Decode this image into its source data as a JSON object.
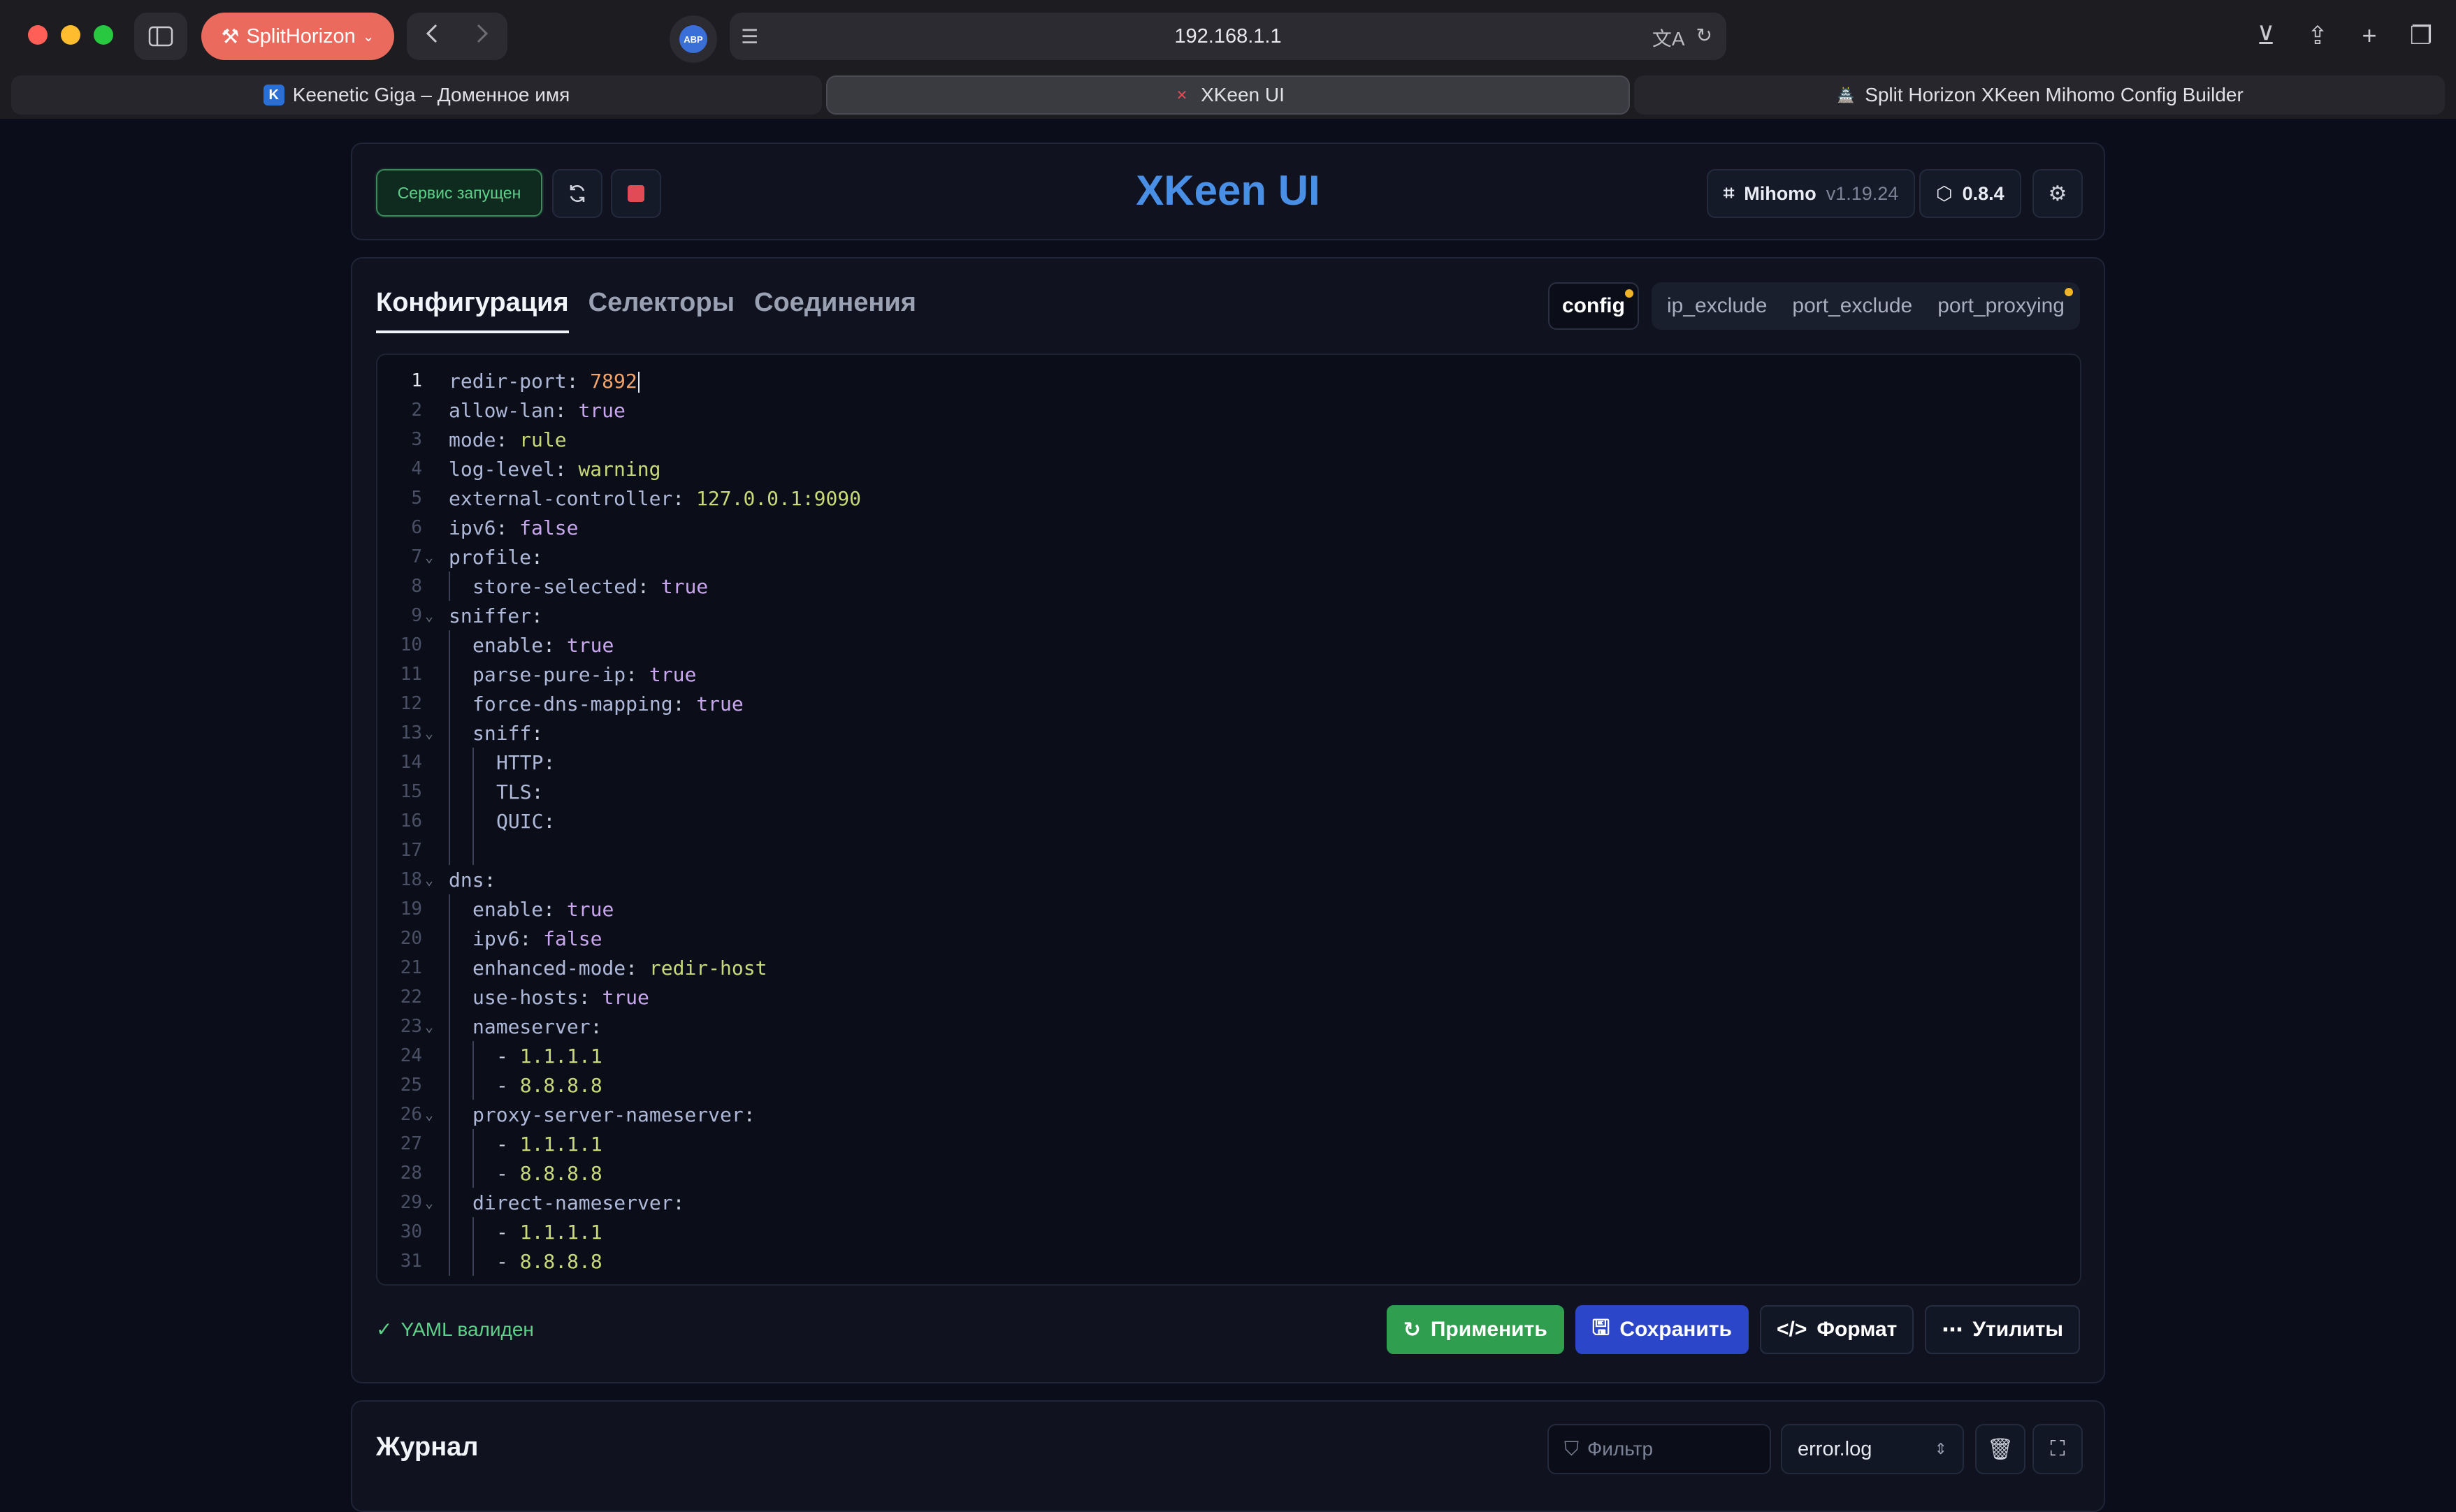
{
  "browser": {
    "profile_label": "SplitHorizon",
    "url": "192.168.1.1",
    "abp_label": "ABP",
    "tabs": [
      {
        "title": "Keenetic Giga – Доменное имя",
        "favicon": "K"
      },
      {
        "title": "XKeen UI",
        "favicon": "✕"
      },
      {
        "title": "Split Horizon XKeen Mihomo Config Builder",
        "favicon": "🏯"
      }
    ]
  },
  "header": {
    "status": "Сервис запущен",
    "title": "XKeen UI",
    "core_name": "Mihomo",
    "core_version": "v1.19.24",
    "ui_version": "0.8.4"
  },
  "nav": {
    "tabs": [
      "Конфигурация",
      "Селекторы",
      "Соединения"
    ],
    "active": 0
  },
  "files": {
    "active": "config",
    "others": [
      "ip_exclude",
      "port_exclude",
      "port_proxying"
    ]
  },
  "editor": {
    "lines": [
      {
        "n": "1",
        "indent": 0,
        "key": "redir-port",
        "val": "7892",
        "vt": "num"
      },
      {
        "n": "2",
        "indent": 0,
        "key": "allow-lan",
        "val": "true",
        "vt": "bool"
      },
      {
        "n": "3",
        "indent": 0,
        "key": "mode",
        "val": "rule",
        "vt": "str"
      },
      {
        "n": "4",
        "indent": 0,
        "key": "log-level",
        "val": "warning",
        "vt": "str"
      },
      {
        "n": "5",
        "indent": 0,
        "key": "external-controller",
        "val": "127.0.0.1:9090",
        "vt": "str"
      },
      {
        "n": "6",
        "indent": 0,
        "key": "ipv6",
        "val": "false",
        "vt": "bool"
      },
      {
        "n": "7",
        "indent": 0,
        "key": "profile",
        "val": "",
        "vt": "",
        "fold": true
      },
      {
        "n": "8",
        "indent": 1,
        "key": "store-selected",
        "val": "true",
        "vt": "bool"
      },
      {
        "n": "9",
        "indent": 0,
        "key": "sniffer",
        "val": "",
        "vt": "",
        "fold": true
      },
      {
        "n": "10",
        "indent": 1,
        "key": "enable",
        "val": "true",
        "vt": "bool"
      },
      {
        "n": "11",
        "indent": 1,
        "key": "parse-pure-ip",
        "val": "true",
        "vt": "bool"
      },
      {
        "n": "12",
        "indent": 1,
        "key": "force-dns-mapping",
        "val": "true",
        "vt": "bool"
      },
      {
        "n": "13",
        "indent": 1,
        "key": "sniff",
        "val": "",
        "vt": "",
        "fold": true
      },
      {
        "n": "14",
        "indent": 2,
        "key": "HTTP",
        "val": "",
        "vt": ""
      },
      {
        "n": "15",
        "indent": 2,
        "key": "TLS",
        "val": "",
        "vt": ""
      },
      {
        "n": "16",
        "indent": 2,
        "key": "QUIC",
        "val": "",
        "vt": ""
      },
      {
        "n": "17",
        "indent": 2,
        "key": "",
        "val": "",
        "vt": "",
        "blank": true
      },
      {
        "n": "18",
        "indent": 0,
        "key": "dns",
        "val": "",
        "vt": "",
        "fold": true
      },
      {
        "n": "19",
        "indent": 1,
        "key": "enable",
        "val": "true",
        "vt": "bool"
      },
      {
        "n": "20",
        "indent": 1,
        "key": "ipv6",
        "val": "false",
        "vt": "bool"
      },
      {
        "n": "21",
        "indent": 1,
        "key": "enhanced-mode",
        "val": "redir-host",
        "vt": "str"
      },
      {
        "n": "22",
        "indent": 1,
        "key": "use-hosts",
        "val": "true",
        "vt": "bool"
      },
      {
        "n": "23",
        "indent": 1,
        "key": "nameserver",
        "val": "",
        "vt": "",
        "fold": true
      },
      {
        "n": "24",
        "indent": 2,
        "key": "",
        "val": "1.1.1.1",
        "vt": "str",
        "item": true
      },
      {
        "n": "25",
        "indent": 2,
        "key": "",
        "val": "8.8.8.8",
        "vt": "str",
        "item": true
      },
      {
        "n": "26",
        "indent": 1,
        "key": "proxy-server-nameserver",
        "val": "",
        "vt": "",
        "fold": true
      },
      {
        "n": "27",
        "indent": 2,
        "key": "",
        "val": "1.1.1.1",
        "vt": "str",
        "item": true
      },
      {
        "n": "28",
        "indent": 2,
        "key": "",
        "val": "8.8.8.8",
        "vt": "str",
        "item": true
      },
      {
        "n": "29",
        "indent": 1,
        "key": "direct-nameserver",
        "val": "",
        "vt": "",
        "fold": true
      },
      {
        "n": "30",
        "indent": 2,
        "key": "",
        "val": "1.1.1.1",
        "vt": "str",
        "item": true
      },
      {
        "n": "31",
        "indent": 2,
        "key": "",
        "val": "8.8.8.8",
        "vt": "str",
        "item": true
      }
    ]
  },
  "footer": {
    "validation": "YAML валиден",
    "apply": "Применить",
    "save": "Сохранить",
    "format": "Формат",
    "utils": "Утилиты"
  },
  "log": {
    "title": "Журнал",
    "filter_placeholder": "Фильтр",
    "file": "error.log"
  },
  "colors": {
    "accent": "#4a8fe6",
    "success": "#2f9e4f",
    "primary": "#2c46c9",
    "danger": "#e04b56",
    "modified_dot": "#f0b429"
  }
}
